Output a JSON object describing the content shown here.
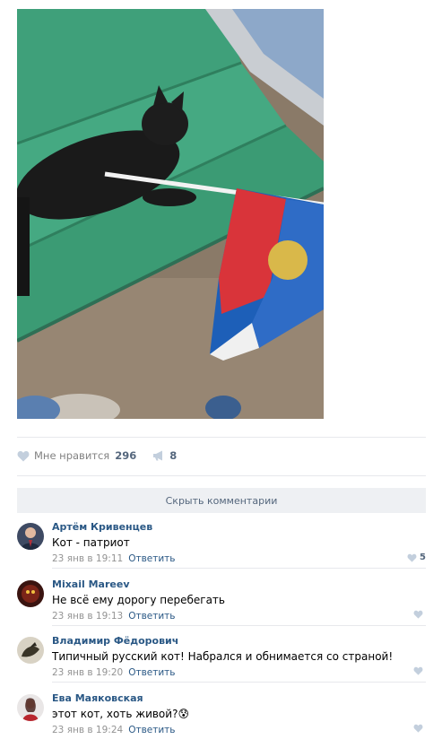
{
  "post": {
    "likes_label": "Мне нравится",
    "likes_count": "296",
    "shares_count": "8",
    "icons": {
      "like": "heart-icon",
      "share": "megaphone-icon"
    }
  },
  "hide_comments_label": "Скрыть комментарии",
  "reply_label": "Ответить",
  "comments": [
    {
      "author": "Артём Кривенцев",
      "text": "Кот - патриот",
      "time": "23 янв в 19:11",
      "likes": "5"
    },
    {
      "author": "Mixail Mareev",
      "text": "Не всё ему дорогу перебегать",
      "time": "23 янв в 19:13",
      "likes": ""
    },
    {
      "author": "Владимир Фёдорович",
      "text": "Типичный русский кот! Набрался и обнимается со страной!",
      "time": "23 янв в 19:20",
      "likes": ""
    },
    {
      "author": "Ева Маяковская",
      "text": "этот кот, хоть живой?😰",
      "time": "23 янв в 19:24",
      "likes": ""
    }
  ],
  "colors": {
    "link": "#2a5885",
    "meta": "#939393",
    "accent": "#55677d"
  }
}
